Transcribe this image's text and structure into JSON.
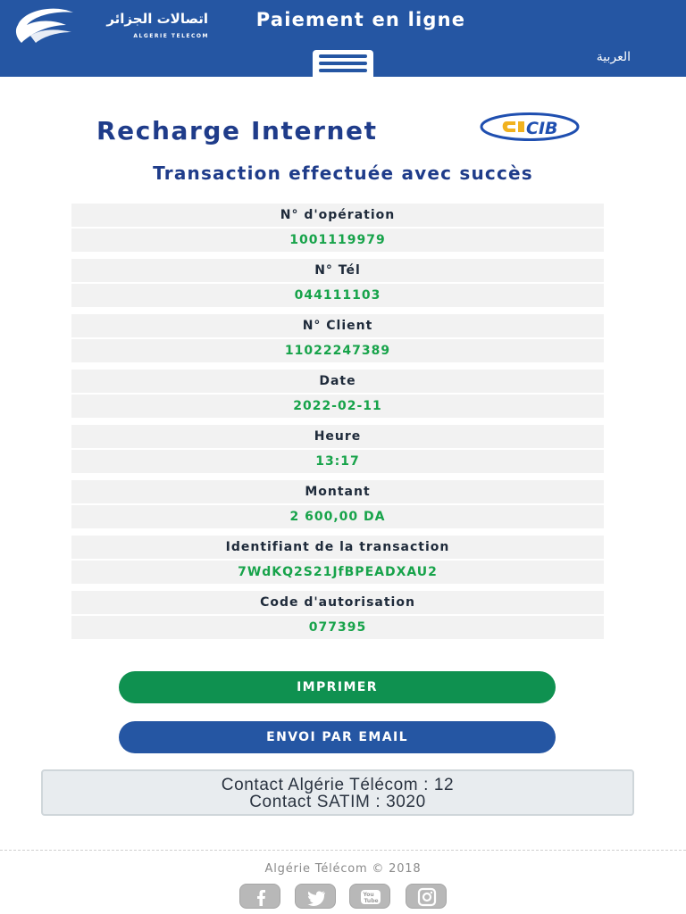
{
  "header": {
    "logo_arabic": "اتصالات الجزائر",
    "logo_latin": "ALGERIE TELECOM",
    "title": "Paiement en ligne",
    "language_link": "العربية"
  },
  "page": {
    "title": "Recharge Internet",
    "cib_logo_text": "CIB",
    "status": "Transaction effectuée avec succès"
  },
  "details": [
    {
      "label": "N° d'opération",
      "value": "1001119979"
    },
    {
      "label": "N° Tél",
      "value": "044111103"
    },
    {
      "label": "N° Client",
      "value": "11022247389"
    },
    {
      "label": "Date",
      "value": "2022-02-11"
    },
    {
      "label": "Heure",
      "value": "13:17"
    },
    {
      "label": "Montant",
      "value": "2 600,00 DA"
    },
    {
      "label": "Identifiant de la transaction",
      "value": "7WdKQ2S21JfBPEADXAU2"
    },
    {
      "label": "Code d'autorisation",
      "value": "077395"
    }
  ],
  "buttons": {
    "print": "IMPRIMER",
    "email": "ENVOI PAR EMAIL"
  },
  "contact": {
    "line1": "Contact Algérie Télécom : 12",
    "line2": "Contact SATIM : 3020"
  },
  "footer": {
    "copyright": "Algérie Télécom © 2018",
    "social": [
      "facebook-icon",
      "twitter-icon",
      "youtube-icon",
      "instagram-icon"
    ]
  },
  "colors": {
    "brand_blue": "#2556a3",
    "title_blue": "#1f3c8a",
    "value_green": "#17a34a",
    "print_green": "#0f9150",
    "row_gray": "#f2f2f2"
  }
}
